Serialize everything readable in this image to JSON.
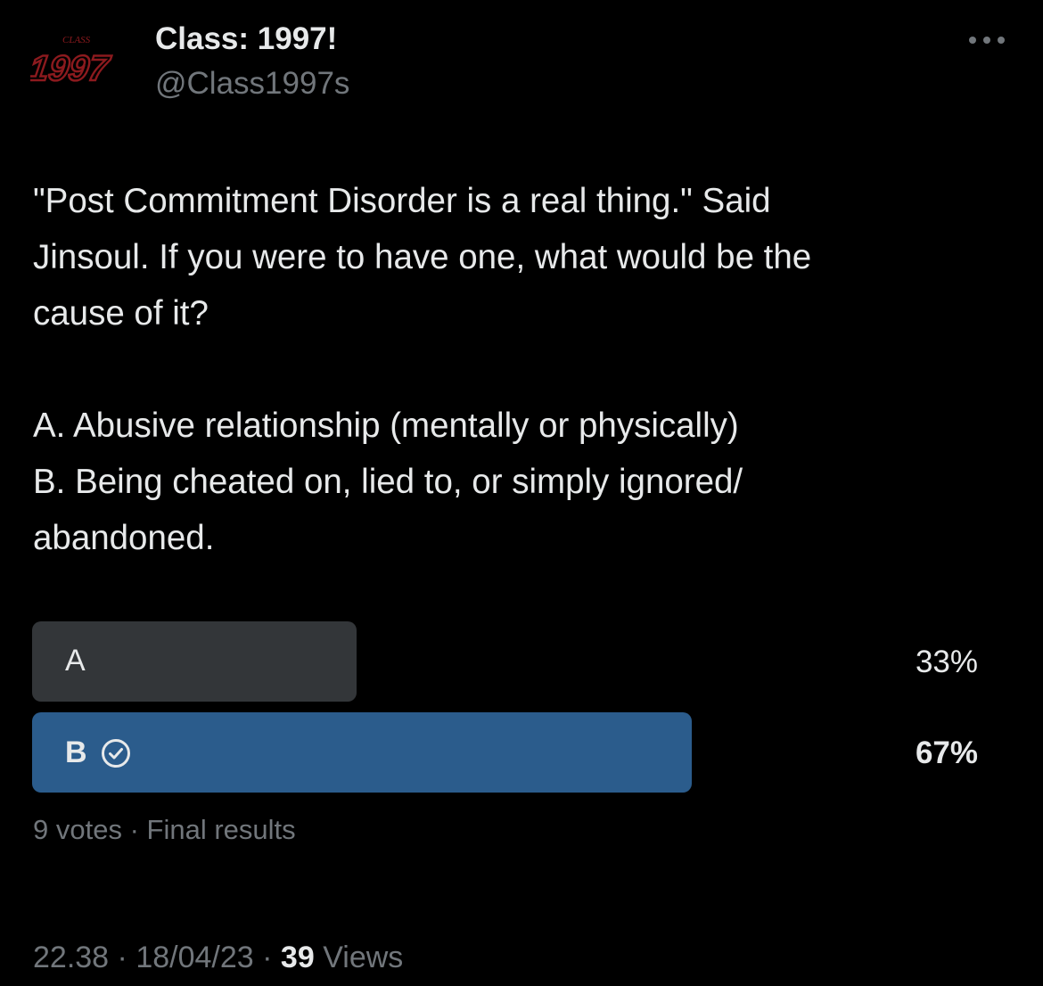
{
  "profile": {
    "display_name": "Class: 1997!",
    "handle": "@Class1997s",
    "avatar_text_small": "CLASS",
    "avatar_text_large": "1997"
  },
  "tweet": {
    "lines": [
      "\"Post Commitment Disorder is a real thing.\" Said",
      "Jinsoul. If you were to have one, what would be the",
      "cause of it?",
      "",
      "A. Abusive relationship (mentally or physically)",
      "B. Being cheated on, lied to, or simply ignored/",
      "abandoned."
    ]
  },
  "poll": {
    "options": [
      {
        "label": "A",
        "percent_text": "33%",
        "share": 0.33,
        "winner": false
      },
      {
        "label": "B",
        "percent_text": "67%",
        "share": 0.67,
        "winner": true
      }
    ],
    "votes_text": "9 votes",
    "separator": "·",
    "status_text": "Final results"
  },
  "meta": {
    "time": "22.38",
    "date": "18/04/23",
    "separator": "·",
    "views_count": "39",
    "views_label": "Views"
  },
  "colors": {
    "background": "#000000",
    "text_primary": "#e7e9ea",
    "text_secondary": "#71767b",
    "poll_bar": "#333639",
    "poll_bar_winner": "#2b5c8c",
    "avatar_red": "#8c1a1e"
  },
  "icons": {
    "more": "more-horizontal-icon",
    "winner": "check-circle-icon"
  }
}
